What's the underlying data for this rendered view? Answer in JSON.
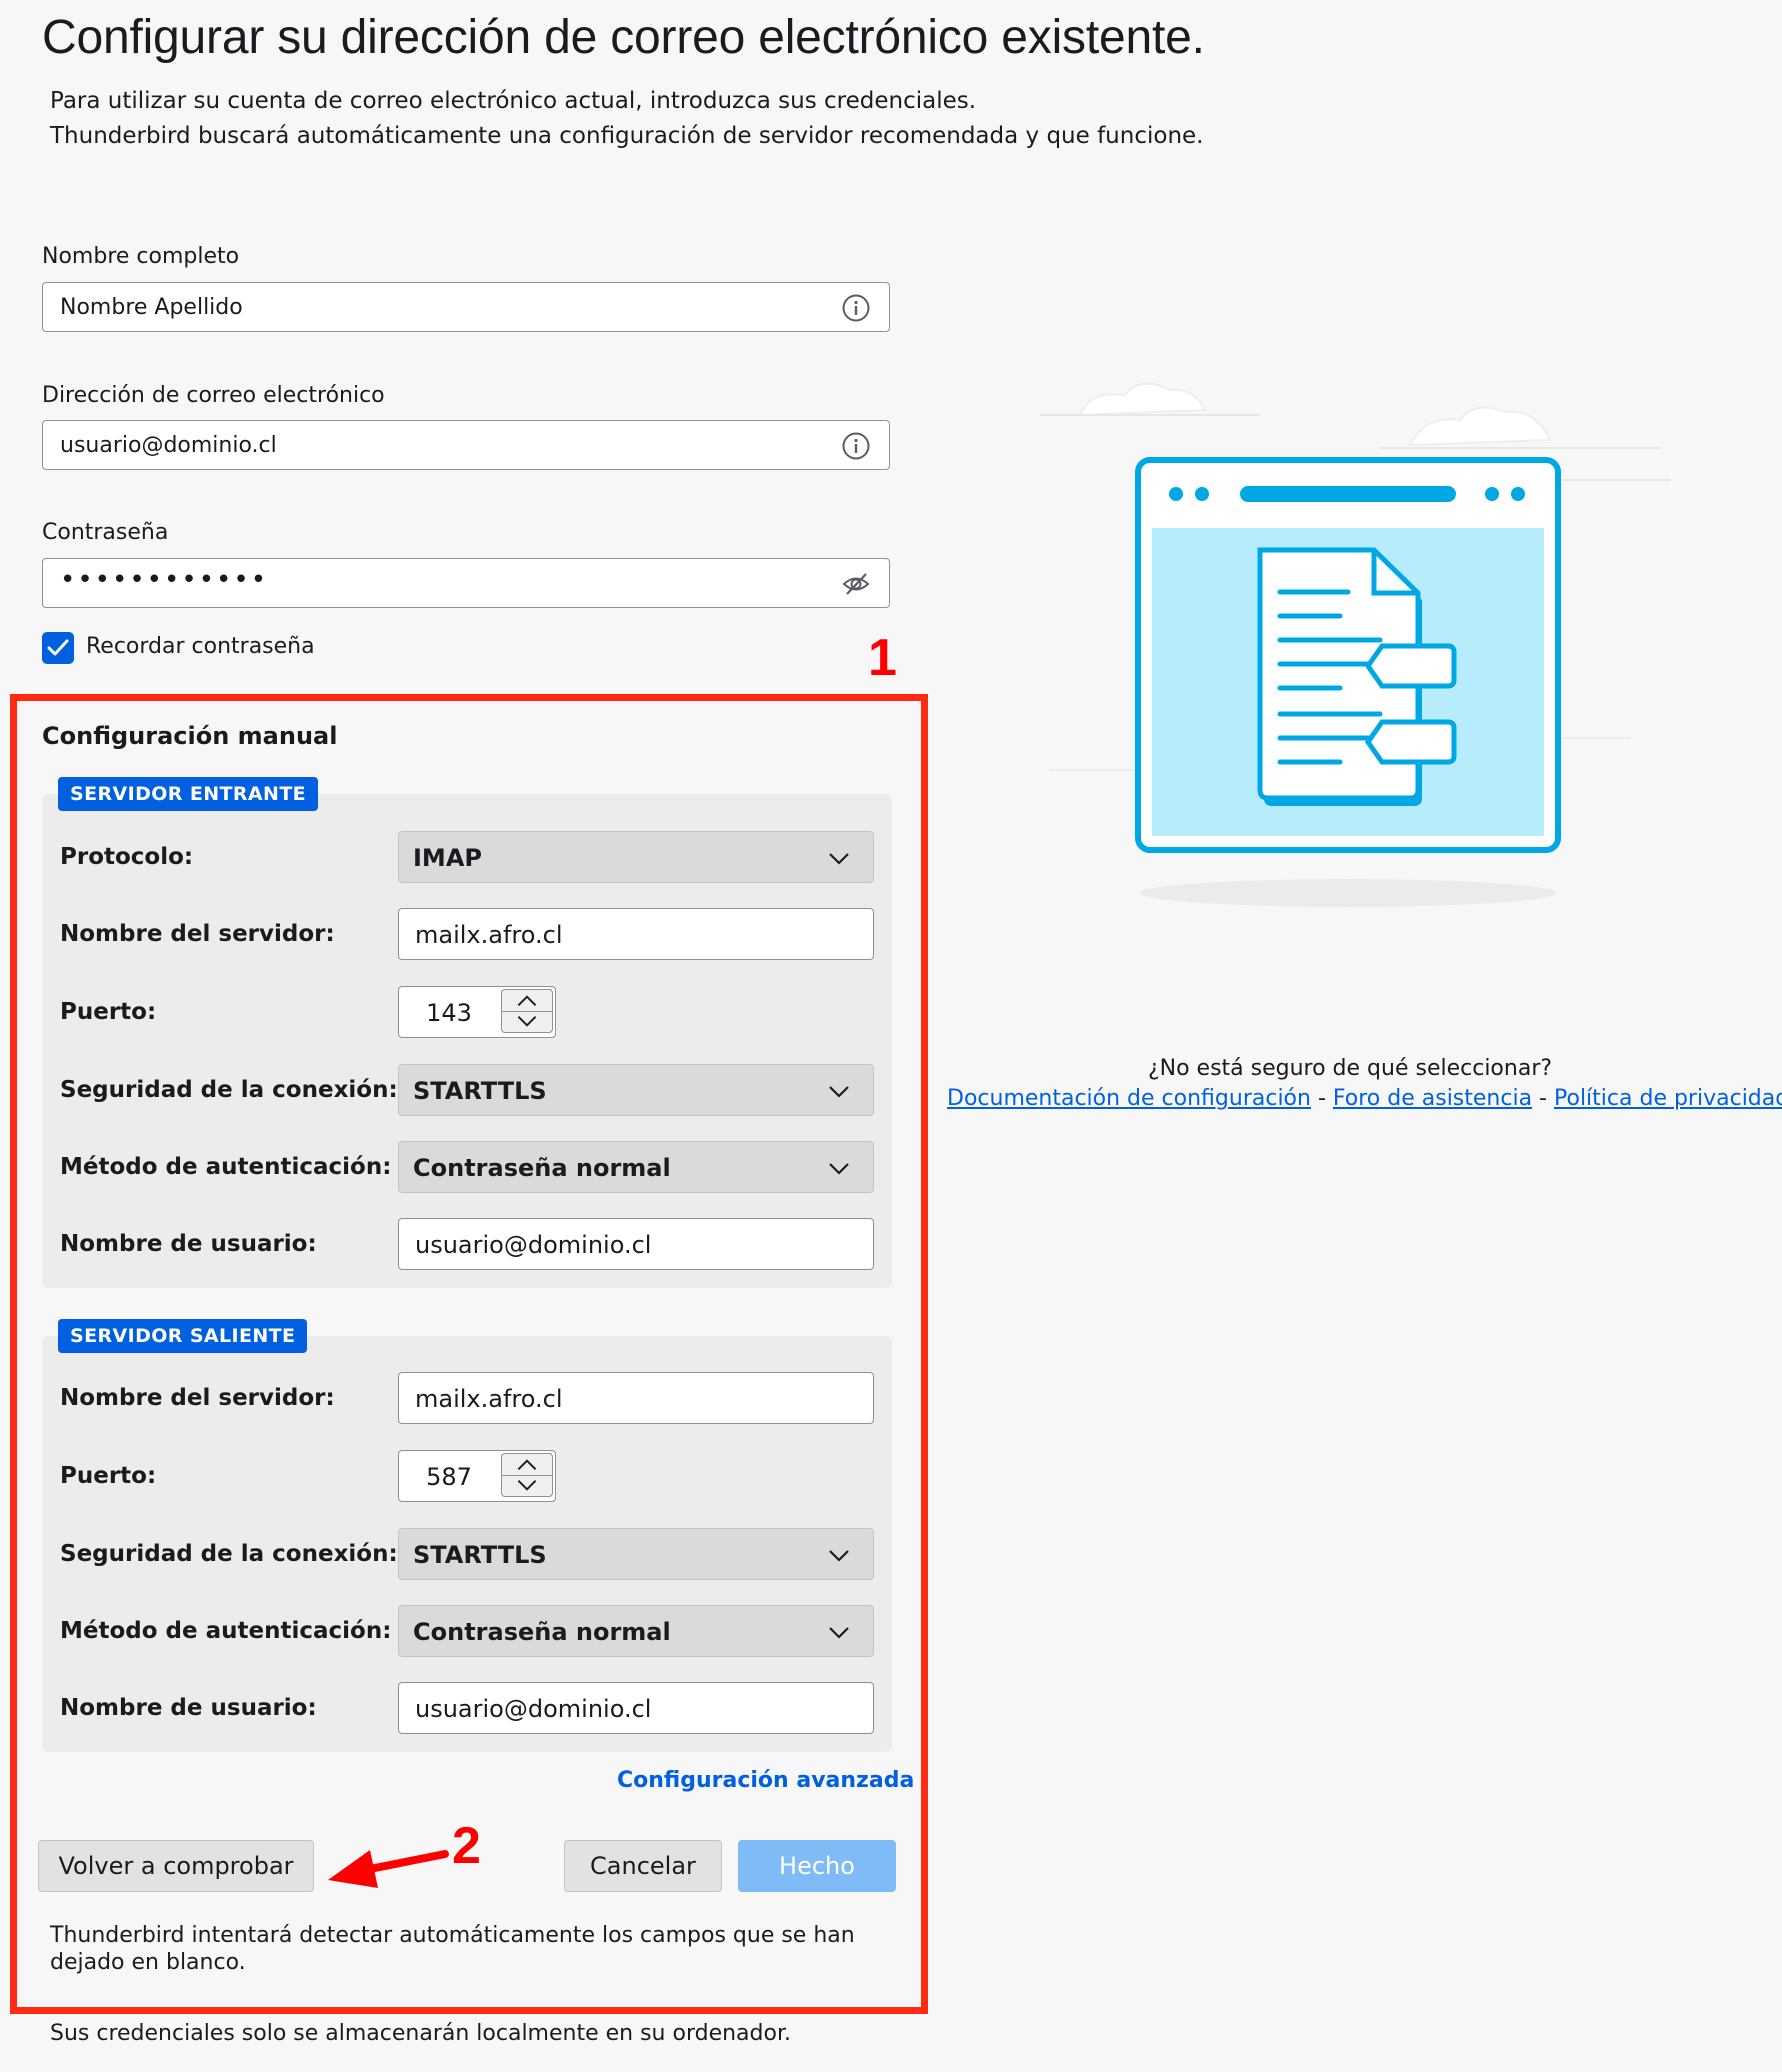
{
  "header": {
    "title": "Configurar su dirección de correo electrónico existente.",
    "intro_line1": "Para utilizar su cuenta de correo electrónico actual, introduzca sus credenciales.",
    "intro_line2": "Thunderbird buscará automáticamente una configuración de servidor recomendada y que funcione."
  },
  "form": {
    "fullname_label": "Nombre completo",
    "fullname_value": "Nombre Apellido",
    "email_label": "Dirección de correo electrónico",
    "email_value": "usuario@dominio.cl",
    "password_label": "Contraseña",
    "password_value": "••••••••••••",
    "remember_label": "Recordar contraseña",
    "remember_checked": true
  },
  "annotations": {
    "marker_1": "1",
    "marker_2": "2",
    "frame_color": "#ff2a12"
  },
  "manual": {
    "title": "Configuración manual",
    "incoming": {
      "badge": "SERVIDOR ENTRANTE",
      "protocol_label": "Protocolo:",
      "protocol_value": "IMAP",
      "server_label": "Nombre del servidor:",
      "server_value": "mailx.afro.cl",
      "port_label": "Puerto:",
      "port_value": "143",
      "security_label": "Seguridad de la conexión:",
      "security_value": "STARTTLS",
      "auth_label": "Método de autenticación:",
      "auth_value": "Contraseña normal",
      "username_label": "Nombre de usuario:",
      "username_value": "usuario@dominio.cl"
    },
    "outgoing": {
      "badge": "SERVIDOR SALIENTE",
      "server_label": "Nombre del servidor:",
      "server_value": "mailx.afro.cl",
      "port_label": "Puerto:",
      "port_value": "587",
      "security_label": "Seguridad de la conexión:",
      "security_value": "STARTTLS",
      "auth_label": "Método de autenticación:",
      "auth_value": "Contraseña normal",
      "username_label": "Nombre de usuario:",
      "username_value": "usuario@dominio.cl"
    },
    "advanced_link": "Configuración avanzada"
  },
  "buttons": {
    "retest": "Volver a comprobar",
    "cancel": "Cancelar",
    "done": "Hecho"
  },
  "notes": {
    "autodetect": "Thunderbird intentará detectar automáticamente los campos que se han dejado en blanco.",
    "local_storage": "Sus credenciales solo se almacenarán localmente en su ordenador."
  },
  "help": {
    "question": "¿No está seguro de qué seleccionar?",
    "doc_link": "Documentación de configuración",
    "forum_link": "Foro de asistencia",
    "privacy_link": "Política de privacidad",
    "separator": " - "
  },
  "colors": {
    "accent": "#0060df",
    "illustration": "#00a7e5"
  }
}
